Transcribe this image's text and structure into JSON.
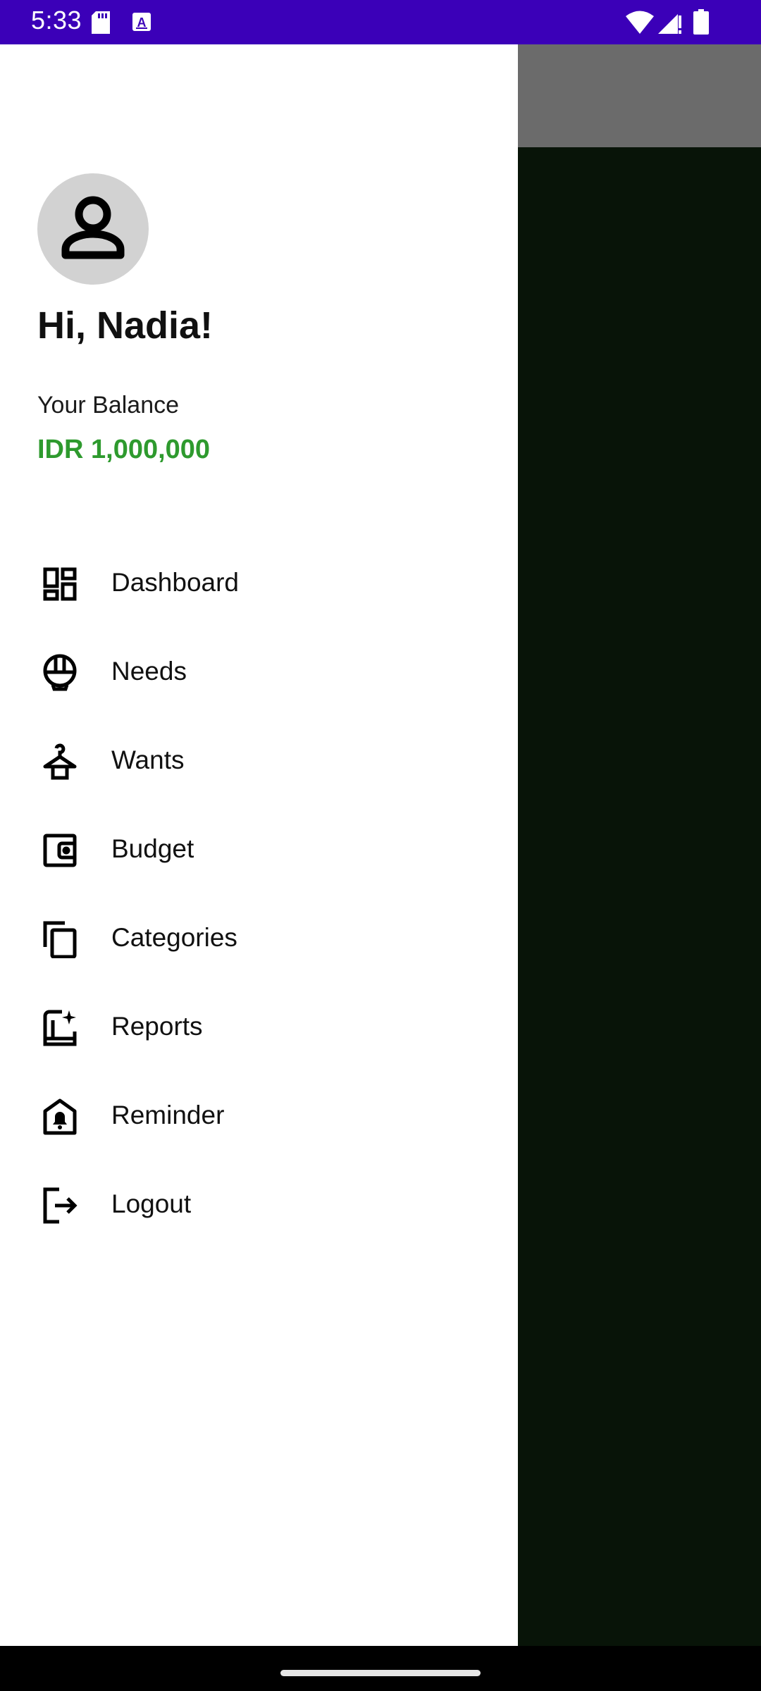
{
  "status_bar": {
    "time": "5:33",
    "icons": [
      "sd-card-icon",
      "a-notification-icon",
      "wifi-icon",
      "signal-icon",
      "battery-icon"
    ],
    "background": "#3b00b8"
  },
  "drawer": {
    "greeting": "Hi, Nadia!",
    "balance_label": "Your Balance",
    "balance_value": "IDR 1,000,000",
    "balance_color": "#2e9a2e",
    "menu": [
      {
        "label": "Dashboard",
        "icon": "dashboard-icon"
      },
      {
        "label": "Needs",
        "icon": "rice-bowl-icon"
      },
      {
        "label": "Wants",
        "icon": "hanger-icon"
      },
      {
        "label": "Budget",
        "icon": "wallet-icon"
      },
      {
        "label": "Categories",
        "icon": "copy-icon"
      },
      {
        "label": "Reports",
        "icon": "reports-icon"
      },
      {
        "label": "Reminder",
        "icon": "bell-home-icon"
      },
      {
        "label": "Logout",
        "icon": "logout-icon"
      }
    ]
  }
}
